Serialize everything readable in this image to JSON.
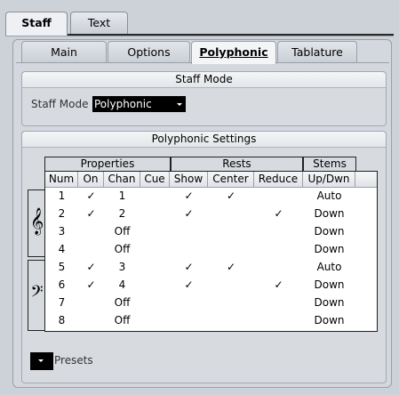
{
  "top_tabs": [
    {
      "label": "Staff",
      "active": true
    },
    {
      "label": "Text",
      "active": false
    }
  ],
  "sub_tabs": [
    {
      "label": "Main",
      "active": false
    },
    {
      "label": "Options",
      "active": false
    },
    {
      "label": "Polyphonic",
      "active": true
    },
    {
      "label": "Tablature",
      "active": false
    }
  ],
  "staff_mode": {
    "title": "Staff Mode",
    "label": "Staff Mode",
    "value": "Polyphonic"
  },
  "polyphonic": {
    "title": "Polyphonic Settings",
    "groups": [
      "Properties",
      "Rests",
      "Stems"
    ],
    "columns": [
      "Num",
      "On",
      "Chan",
      "Cue",
      "Show",
      "Center",
      "Reduce",
      "Up/Dwn"
    ],
    "rows": [
      [
        "1",
        "✓",
        "1",
        "",
        "✓",
        "✓",
        "",
        "Auto"
      ],
      [
        "2",
        "✓",
        "2",
        "",
        "✓",
        "",
        "✓",
        "Down"
      ],
      [
        "3",
        "",
        "Off",
        "",
        "",
        "",
        "",
        "Down"
      ],
      [
        "4",
        "",
        "Off",
        "",
        "",
        "",
        "",
        "Down"
      ],
      [
        "5",
        "✓",
        "3",
        "",
        "✓",
        "✓",
        "",
        "Auto"
      ],
      [
        "6",
        "✓",
        "4",
        "",
        "✓",
        "",
        "✓",
        "Down"
      ],
      [
        "7",
        "",
        "Off",
        "",
        "",
        "",
        "",
        "Down"
      ],
      [
        "8",
        "",
        "Off",
        "",
        "",
        "",
        "",
        "Down"
      ]
    ]
  },
  "clefs": {
    "treble": "𝄞",
    "bass": "𝄢"
  },
  "presets_label": "Presets"
}
